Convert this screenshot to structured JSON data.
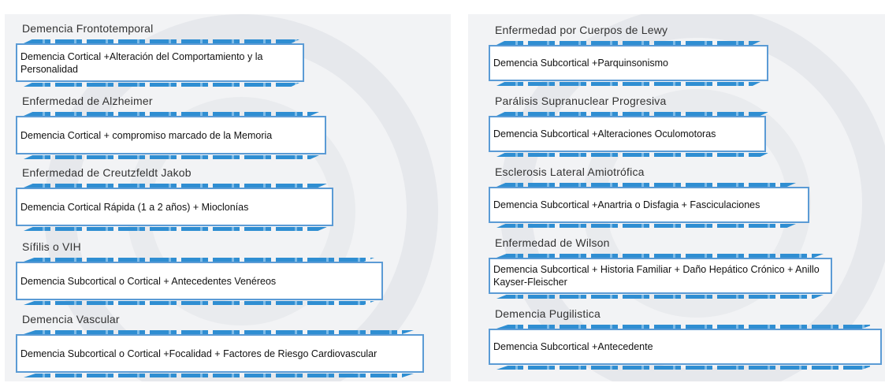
{
  "left": [
    {
      "title": "Demencia Frontotemporal",
      "desc": "Demencia Cortical +Alteración del Comportamiento y la Personalidad"
    },
    {
      "title": "Enfermedad de Alzheimer",
      "desc": "Demencia Cortical + compromiso marcado de la Memoria"
    },
    {
      "title": "Enfermedad de Creutzfeldt Jakob",
      "desc": "Demencia Cortical Rápida (1 a 2 años) + Mioclonías"
    },
    {
      "title": "Sífilis o VIH",
      "desc": "Demencia Subcortical o Cortical + Antecedentes Venéreos"
    },
    {
      "title": "Demencia Vascular",
      "desc": "Demencia Subcortical o Cortical +Focalidad + Factores de Riesgo Cardiovascular"
    }
  ],
  "right": [
    {
      "title": "Enfermedad por Cuerpos de Lewy",
      "desc": "Demencia Subcortical +Parquinsonismo"
    },
    {
      "title": "Parálisis Supranuclear Progresiva",
      "desc": "Demencia Subcortical +Alteraciones Oculomotoras"
    },
    {
      "title": "Esclerosis Lateral Amiotrófica",
      "desc": "Demencia Subcortical +Anartria o Disfagia + Fasciculaciones"
    },
    {
      "title": "Enfermedad de Wilson",
      "desc": "Demencia Subcortical + Historia Familiar + Daño Hepático Crónico + Anillo Kayser-Fleischer"
    },
    {
      "title": "Demencia Pugilistica",
      "desc": "Demencia Subcortical +Antecedente"
    }
  ]
}
